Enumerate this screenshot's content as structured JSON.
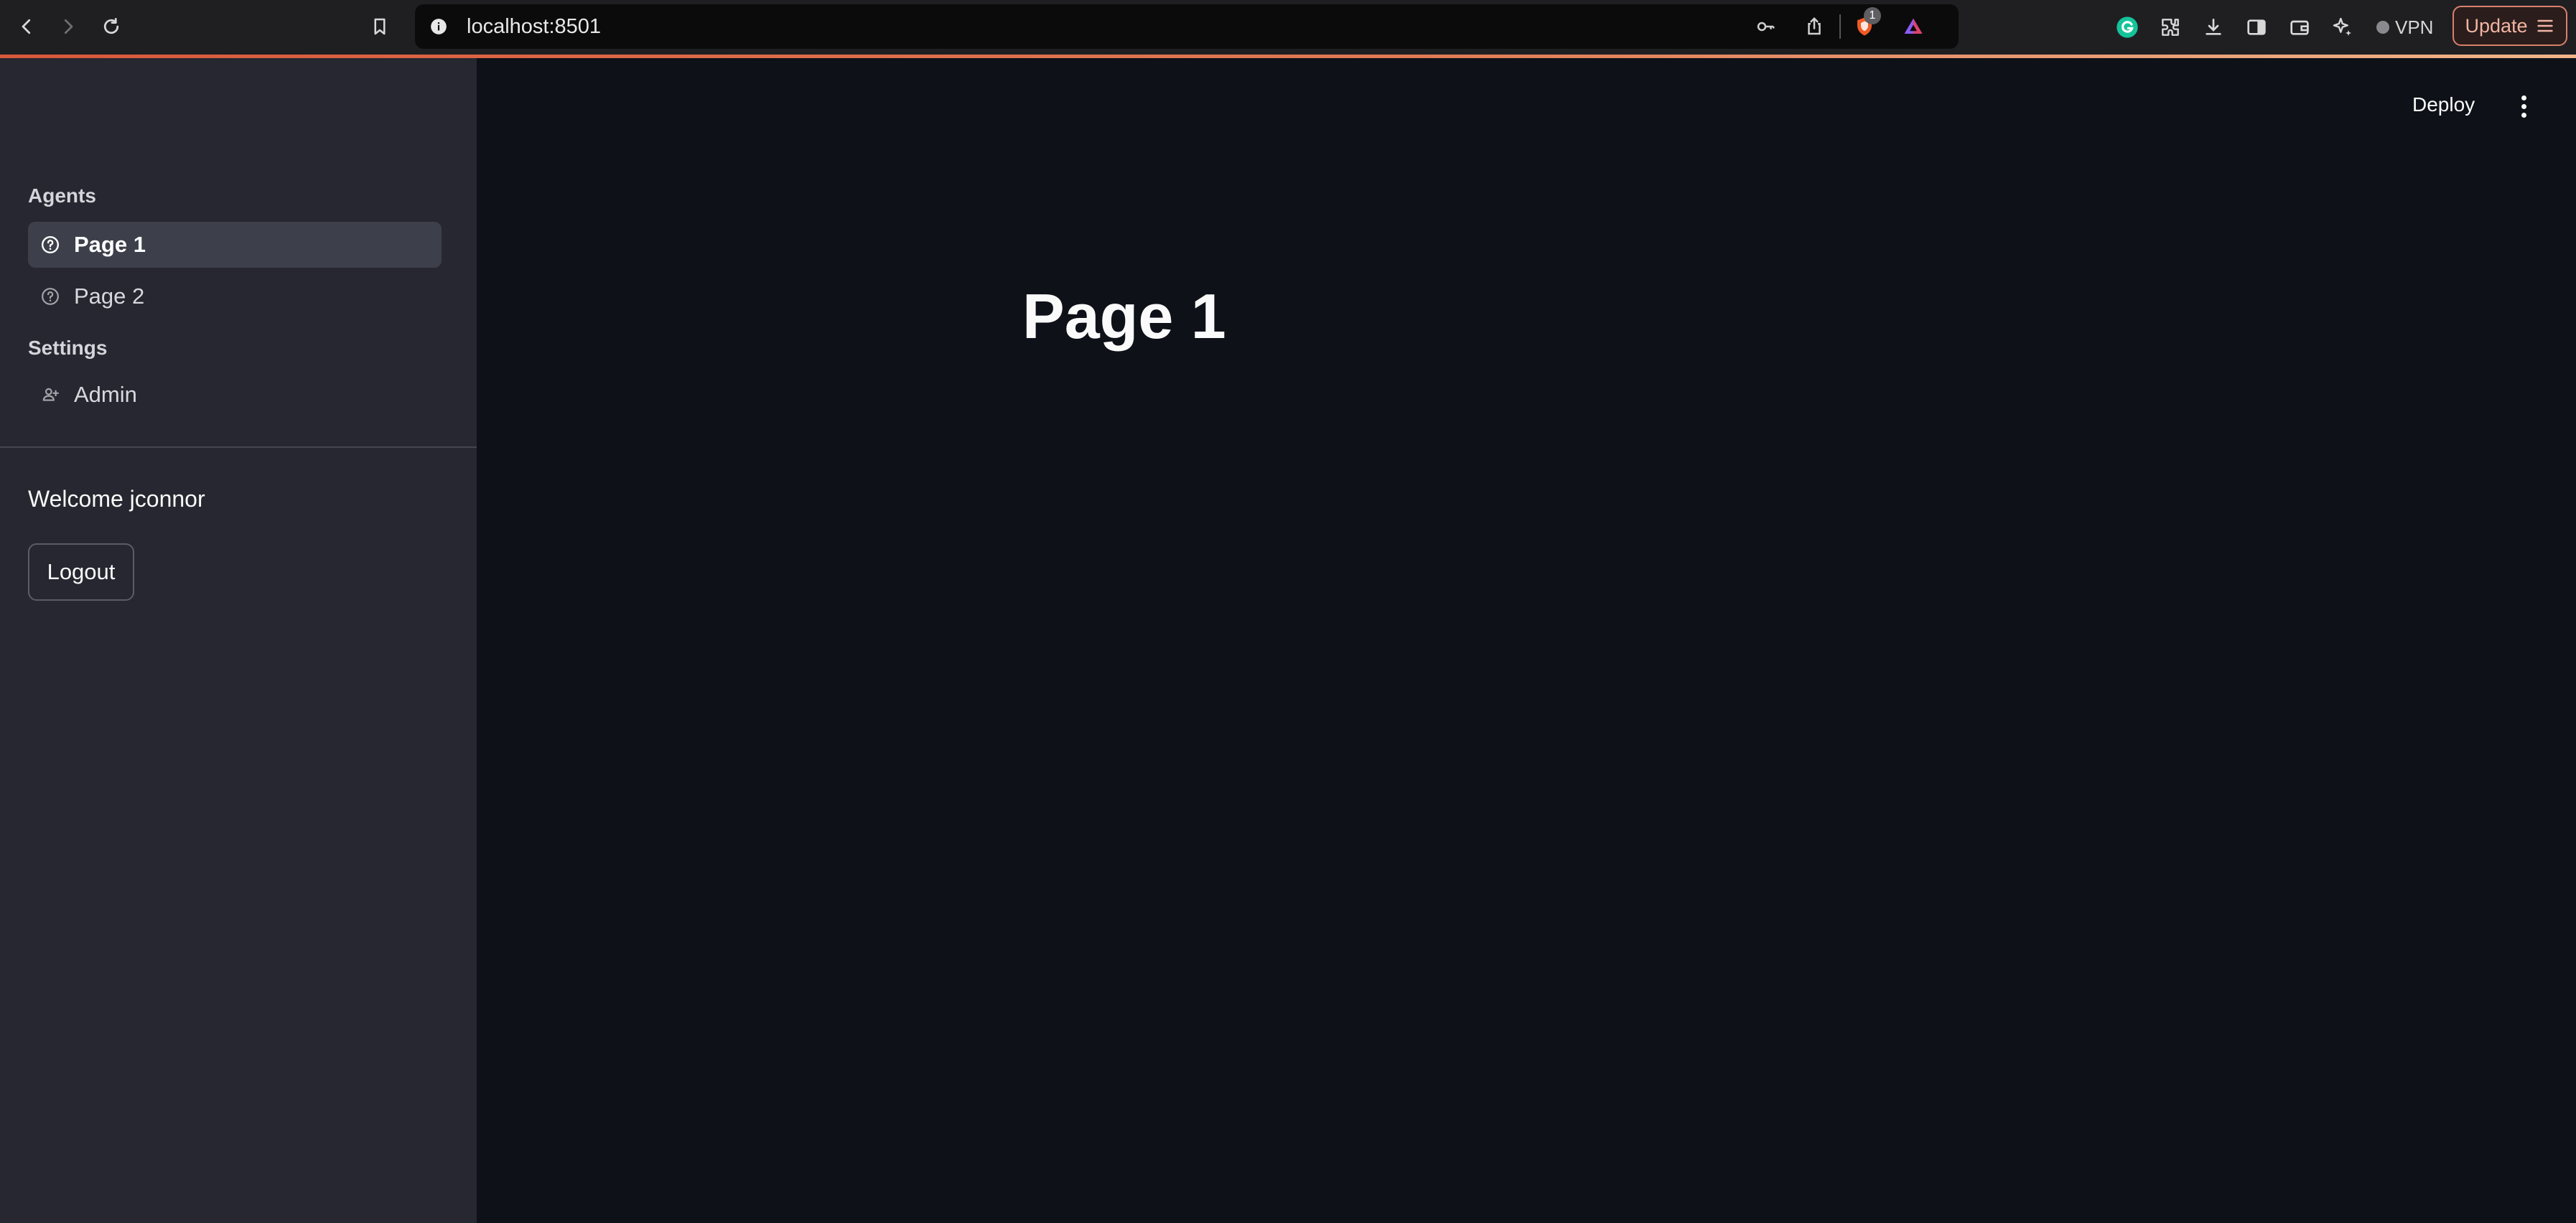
{
  "browser": {
    "url": "localhost:8501",
    "shields_count": "1",
    "vpn_label": "VPN",
    "update_label": "Update",
    "icons": [
      "back-icon",
      "forward-icon",
      "reload-icon",
      "bookmark-icon",
      "site-info-icon",
      "password-key-icon",
      "share-icon",
      "brave-shields-icon",
      "brave-rewards-icon",
      "grammarly-icon",
      "extensions-icon",
      "downloads-icon",
      "sidebar-icon",
      "wallet-icon",
      "leo-ai-icon",
      "menu-icon"
    ]
  },
  "sidebar": {
    "sections": [
      {
        "title": "Agents",
        "items": [
          {
            "label": "Page 1",
            "icon": "help-circle-icon",
            "active": true
          },
          {
            "label": "Page 2",
            "icon": "help-circle-icon",
            "active": false
          }
        ]
      },
      {
        "title": "Settings",
        "items": [
          {
            "label": "Admin",
            "icon": "person-add-icon",
            "active": false
          }
        ]
      }
    ],
    "welcome": "Welcome jconnor",
    "logout_label": "Logout"
  },
  "header": {
    "deploy_label": "Deploy"
  },
  "main": {
    "title": "Page 1"
  },
  "colors": {
    "accent": "#d9583b",
    "sidebar_bg": "#262730",
    "main_bg": "#0e1117"
  }
}
